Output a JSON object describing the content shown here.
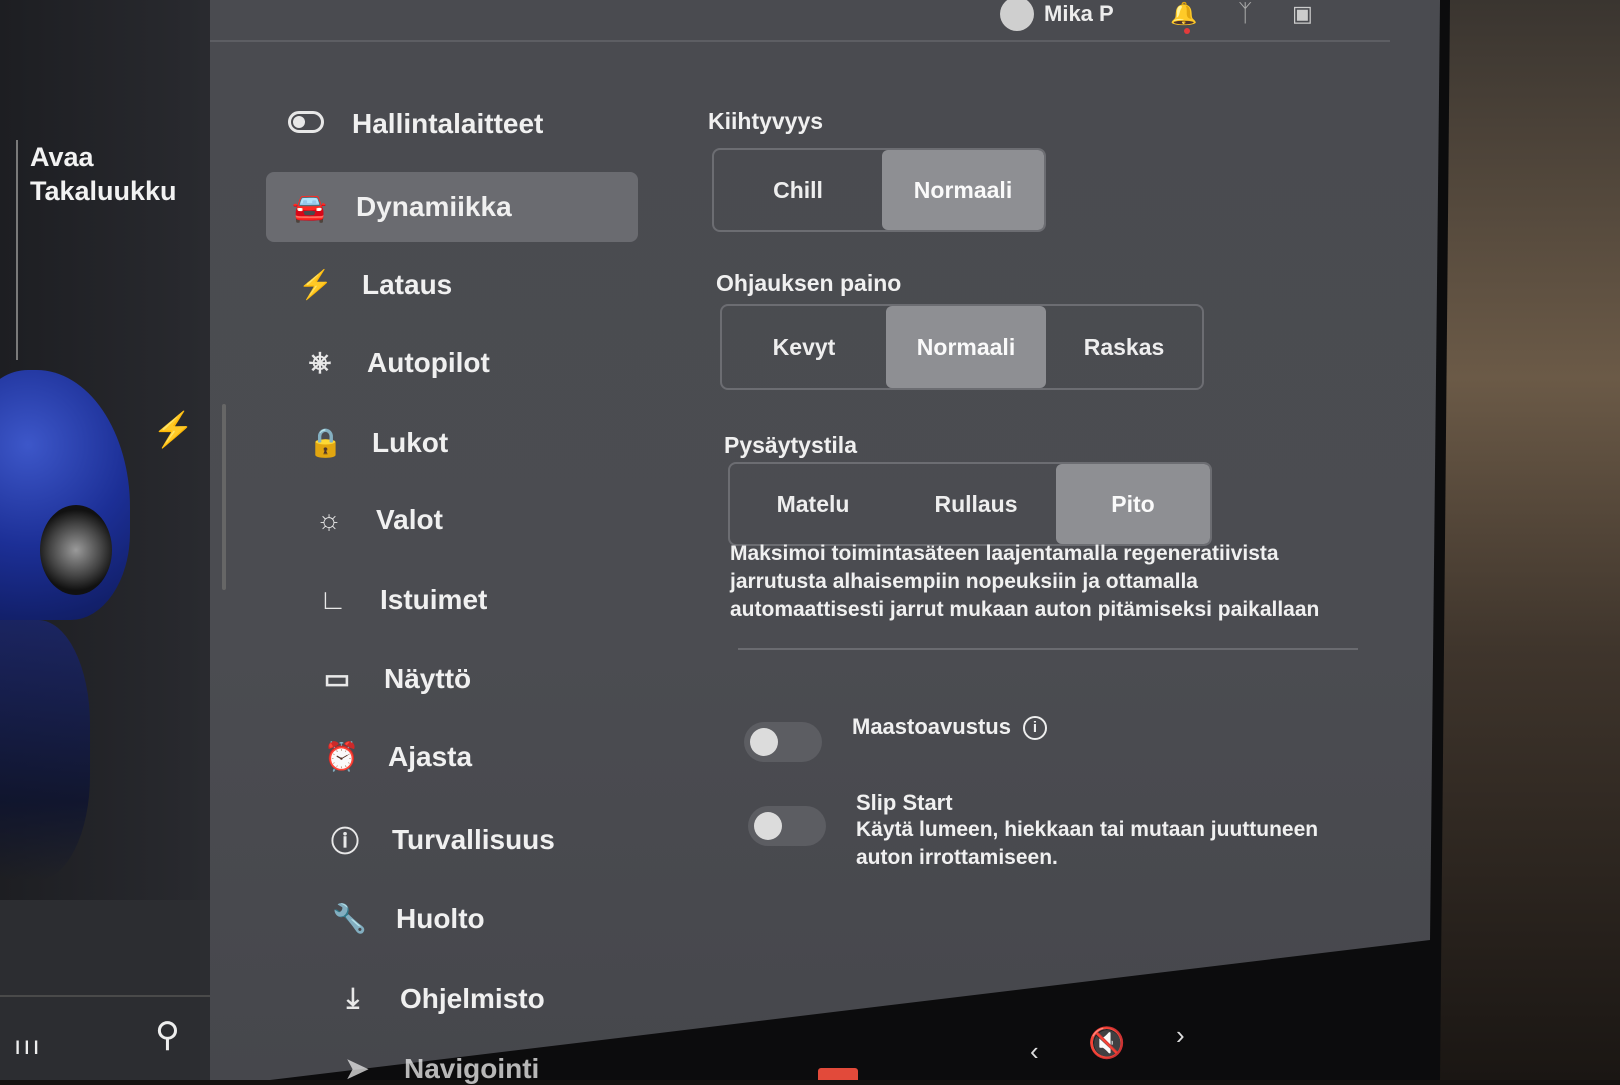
{
  "status_bar": {
    "user_name": "Mika P",
    "icons": [
      "user-icon",
      "bell-icon",
      "bluetooth-icon",
      "signal-icon"
    ]
  },
  "car_panel": {
    "trunk_line1": "Avaa",
    "trunk_line2": "Takaluukku"
  },
  "menu": {
    "items": [
      {
        "label": "Hallintalaitteet",
        "icon": "toggle-icon"
      },
      {
        "label": "Dynamiikka",
        "icon": "car-icon",
        "active": true
      },
      {
        "label": "Lataus",
        "icon": "bolt-icon"
      },
      {
        "label": "Autopilot",
        "icon": "steering-wheel-icon"
      },
      {
        "label": "Lukot",
        "icon": "lock-icon"
      },
      {
        "label": "Valot",
        "icon": "sun-icon"
      },
      {
        "label": "Istuimet",
        "icon": "seat-icon"
      },
      {
        "label": "Näyttö",
        "icon": "display-icon"
      },
      {
        "label": "Ajasta",
        "icon": "alarm-icon"
      },
      {
        "label": "Turvallisuus",
        "icon": "alert-icon"
      },
      {
        "label": "Huolto",
        "icon": "wrench-icon"
      },
      {
        "label": "Ohjelmisto",
        "icon": "download-icon"
      },
      {
        "label": "Navigointi",
        "icon": "navigation-icon"
      }
    ]
  },
  "acceleration": {
    "title": "Kiihtyvyys",
    "options": [
      "Chill",
      "Normaali"
    ],
    "selected": "Normaali"
  },
  "steering": {
    "title": "Ohjauksen paino",
    "options": [
      "Kevyt",
      "Normaali",
      "Raskas"
    ],
    "selected": "Normaali"
  },
  "stopping": {
    "title": "Pysäytystila",
    "options": [
      "Matelu",
      "Rullaus",
      "Pito"
    ],
    "selected": "Pito",
    "description": "Maksimoi toimintasäteen laajentamalla regeneratiivista jarrutusta alhaisempiin nopeuksiin ja ottamalla automaattisesti jarrut mukaan auton pitämiseksi paikallaan"
  },
  "terrain_assist": {
    "label": "Maastoavustus",
    "enabled": false
  },
  "slip_start": {
    "label": "Slip Start",
    "description": "Käytä lumeen, hiekkaan tai mutaan juuttuneen auton irrottamiseen.",
    "enabled": false
  },
  "bottom_bar": {
    "volume_icon": "volume-muted-icon"
  }
}
